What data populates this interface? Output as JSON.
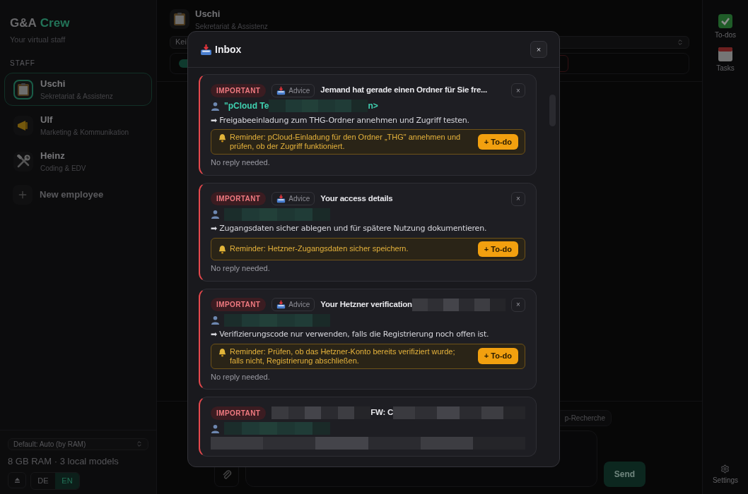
{
  "sidebar": {
    "logo": {
      "primary": "G&A",
      "accent": "Crew"
    },
    "tagline": "Your virtual staff",
    "section_label": "STAFF",
    "staff": [
      {
        "name": "Uschi",
        "role": "Sekretariat & Assistenz",
        "selected": true
      },
      {
        "name": "Ulf",
        "role": "Marketing & Kommunikation",
        "selected": false
      },
      {
        "name": "Heinz",
        "role": "Coding & EDV",
        "selected": false
      }
    ],
    "new_employee": "New employee",
    "model_select": "Default: Auto (by RAM)",
    "system_info": "8 GB RAM · 3 local models",
    "languages": [
      {
        "label": "DE",
        "selected": false
      },
      {
        "label": "EN",
        "selected": true
      }
    ]
  },
  "header": {
    "name": "Uschi",
    "role": "Sekretariat & Assistenz",
    "select_value": "Kei"
  },
  "composer": {
    "chip": "p-Recherche",
    "send": "Send"
  },
  "rail": [
    {
      "label": "To-dos"
    },
    {
      "label": "Tasks"
    }
  ],
  "rail_bottom": {
    "label": "Settings"
  },
  "modal": {
    "title": "Inbox",
    "close": "×",
    "cards": [
      {
        "priority": "IMPORTANT",
        "tag": "Advice",
        "close": "×",
        "title": [
          {
            "kind": "text",
            "text": "Jemand hat gerade einen Ordner für Sie fre..."
          }
        ],
        "sender": [
          {
            "kind": "text",
            "text": "\"pCloud Te"
          },
          {
            "kind": "redaction"
          },
          {
            "kind": "text",
            "text": "n>"
          }
        ],
        "action": [
          {
            "kind": "text",
            "text": "➡ Freigabeeinladung zum THG-Ordner annehmen und Zugriff testen."
          }
        ],
        "reminder": "Reminder: pCloud-Einladung für den Ordner „THG\" annehmen und prüfen, ob der Zugriff funktioniert.",
        "todo": "+ To-do",
        "note": "No reply needed."
      },
      {
        "priority": "IMPORTANT",
        "tag": "Advice",
        "close": "×",
        "title": [
          {
            "kind": "text",
            "text": "Your access details"
          }
        ],
        "sender": [
          {
            "kind": "redaction"
          }
        ],
        "action": [
          {
            "kind": "text",
            "text": "➡ Zugangsdaten sicher ablegen und für spätere Nutzung dokumentieren."
          }
        ],
        "reminder": "Reminder: Hetzner-Zugangsdaten sicher speichern.",
        "todo": "+ To-do",
        "note": "No reply needed."
      },
      {
        "priority": "IMPORTANT",
        "tag": "Advice",
        "close": "×",
        "title": [
          {
            "kind": "text",
            "text": "Your Hetzner verification"
          },
          {
            "kind": "redaction"
          }
        ],
        "sender": [
          {
            "kind": "redaction"
          }
        ],
        "action": [
          {
            "kind": "text",
            "text": "➡ Verifizierungscode nur verwenden, falls die Registrierung noch offen ist."
          }
        ],
        "reminder": "Reminder: Prüfen, ob das Hetzner-Konto bereits verifiziert wurde; falls nicht, Registrierung abschließen.",
        "todo": "+ To-do",
        "note": "No reply needed."
      },
      {
        "priority": "IMPORTANT",
        "title": [
          {
            "kind": "redaction"
          },
          {
            "kind": "text",
            "text": "FW: C"
          },
          {
            "kind": "redaction"
          }
        ],
        "sender": [
          {
            "kind": "redaction"
          }
        ],
        "action": [
          {
            "kind": "redaction"
          }
        ]
      }
    ]
  }
}
